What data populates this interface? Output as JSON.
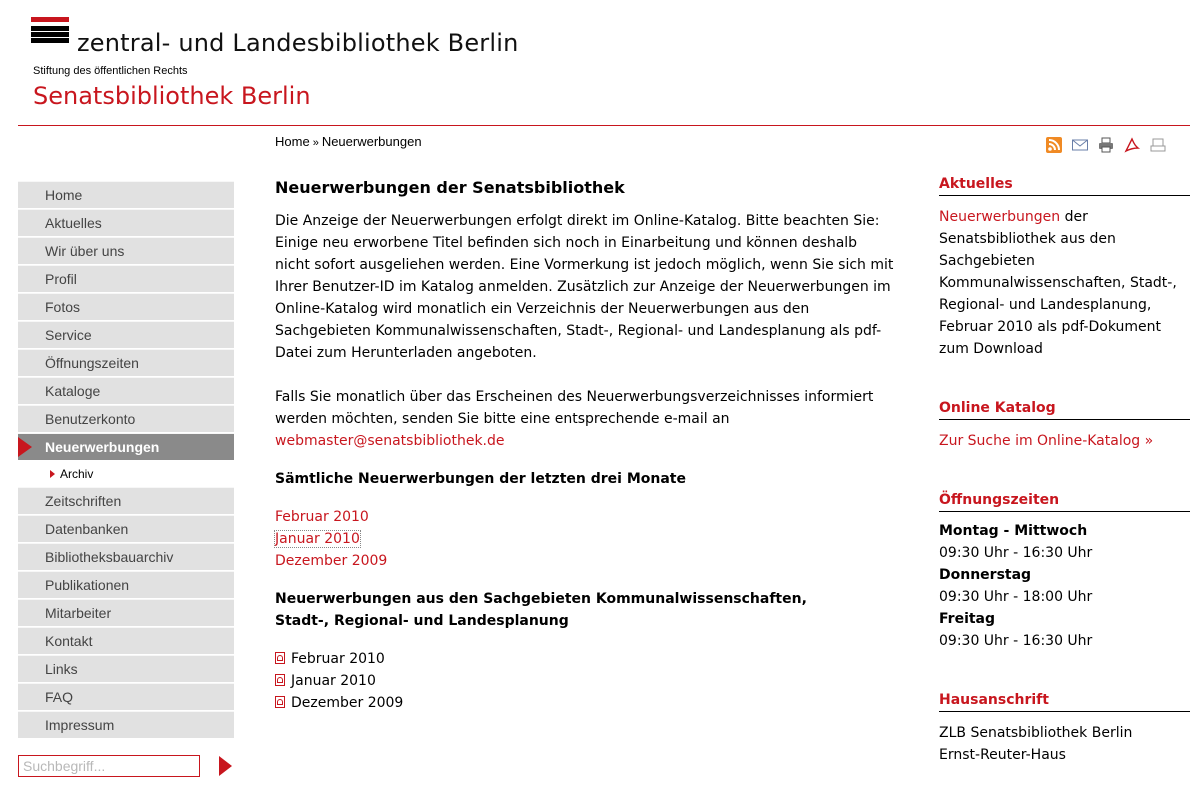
{
  "header": {
    "zlb_name": "zentral- und Landesbibliothek Berlin",
    "stiftung": "Stiftung des öffentlichen Rechts",
    "title": "Senatsbibliothek Berlin",
    "brand_color": "#c8161e"
  },
  "breadcrumb": {
    "home": "Home",
    "separator": "»",
    "current": "Neuerwerbungen"
  },
  "toolbar": {
    "icons": [
      "rss-icon",
      "mail-icon",
      "print-icon",
      "pdf-icon",
      "share-icon"
    ]
  },
  "nav": {
    "items": [
      "Home",
      "Aktuelles",
      "Wir über uns",
      "Profil",
      "Fotos",
      "Service",
      "Öffnungszeiten",
      "Kataloge",
      "Benutzerkonto",
      "Neuerwerbungen"
    ],
    "active": "Neuerwerbungen",
    "sub": "Archiv",
    "items_after": [
      "Zeitschriften",
      "Datenbanken",
      "Bibliotheksbauarchiv",
      "Publikationen",
      "Mitarbeiter",
      "Kontakt",
      "Links",
      "FAQ",
      "Impressum"
    ]
  },
  "search": {
    "placeholder": "Suchbegriff..."
  },
  "main": {
    "title": "Neuerwerbungen der Senatsbibliothek",
    "intro": "Die Anzeige der Neuerwerbungen erfolgt direkt im Online-Katalog. Bitte beachten Sie: Einige neu erworbene Titel befinden sich noch in Einarbeitung und können deshalb nicht sofort ausgeliehen werden. Eine Vormerkung ist jedoch möglich, wenn Sie sich mit Ihrer Benutzer-ID im Katalog anmelden. Zusätzlich zur Anzeige der Neuerwerbungen im Online-Katalog wird  monatlich ein Verzeichnis der Neuerwerbungen aus den Sachgebieten Kommunalwissenschaften, Stadt-, Regional- und Landesplanung als pdf-Datei zum Herunterladen angeboten.",
    "notify_text": "Falls Sie monatlich über das Erscheinen des Neuerwerbungsverzeichnisses informiert werden möchten, senden Sie bitte eine entsprechende e-mail an",
    "email": "webmaster@senatsbibliothek.de",
    "section1_title": "Sämtliche Neuerwerbungen der letzten drei Monate",
    "months": [
      "Februar 2010",
      "Januar 2010",
      "Dezember 2009"
    ],
    "section2_title_line1": "Neuerwerbungen aus den Sachgebieten Kommunalwissenschaften,",
    "section2_title_line2": "Stadt-, Regional- und Landesplanung",
    "pdfs": [
      "Februar 2010",
      "Januar 2010",
      "Dezember 2009"
    ]
  },
  "right": {
    "aktuelles_head": "Aktuelles",
    "aktuelles_link": "Neuerwerbungen",
    "aktuelles_text": " der Senatsbibliothek aus den Sachgebieten Kommunalwissenschaften, Stadt-, Regional- und Landesplanung, Februar 2010 als pdf-Dokument zum Download",
    "katalog_head": "Online Katalog",
    "katalog_link": "Zur Suche im Online-Katalog »",
    "zeiten_head": "Öffnungszeiten",
    "zeiten": [
      {
        "day": "Montag - Mittwoch",
        "time": "09:30 Uhr - 16:30 Uhr"
      },
      {
        "day": "Donnerstag",
        "time": "09:30 Uhr - 18:00 Uhr"
      },
      {
        "day": "Freitag",
        "time": "09:30 Uhr - 16:30 Uhr"
      }
    ],
    "anschrift_head": "Hausanschrift",
    "anschrift_line1": "ZLB Senatsbibliothek Berlin",
    "anschrift_line2": "Ernst-Reuter-Haus"
  }
}
